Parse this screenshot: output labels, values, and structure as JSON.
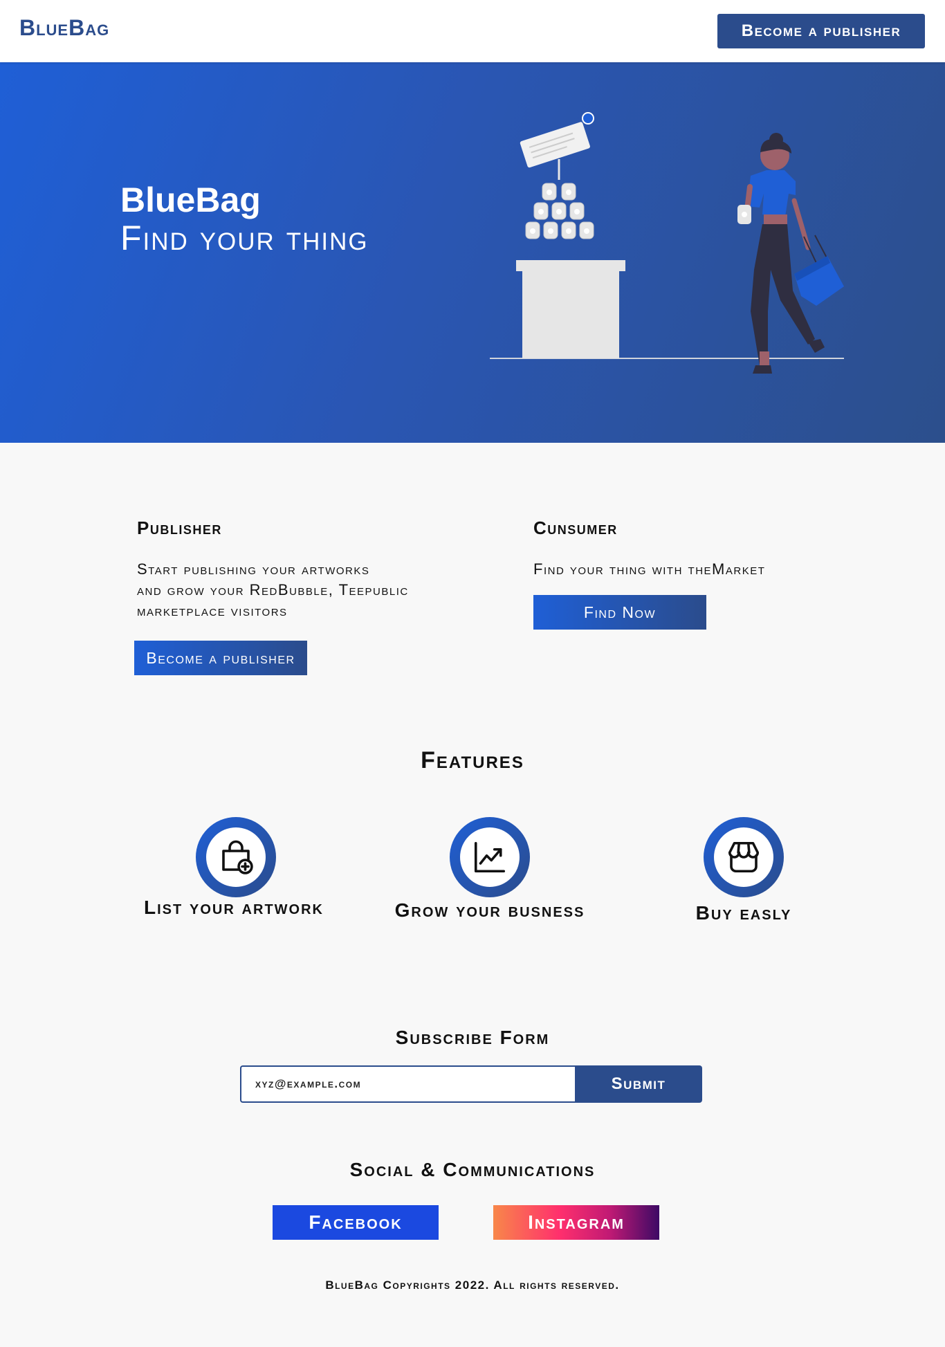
{
  "nav": {
    "brand": "BlueBag",
    "cta_label": "Become a publisher"
  },
  "hero": {
    "title": "BlueBag",
    "subtitle": "Find your thing"
  },
  "publisher": {
    "heading": "Publisher",
    "lines": [
      "Start publishing your artworks",
      "and grow your RedBubble, Teepublic",
      "marketplace visitors"
    ],
    "button_label": "Become a publisher"
  },
  "consumer": {
    "heading": "Cunsumer",
    "text": "Find your thing with theMarket",
    "button_label": "Find Now"
  },
  "features": {
    "title": "Features",
    "items": [
      {
        "icon": "bag-plus-icon",
        "label": "List your artwork"
      },
      {
        "icon": "chart-line-icon",
        "label": "Grow your busness"
      },
      {
        "icon": "storefront-icon",
        "label": "Buy easly"
      }
    ]
  },
  "subscribe": {
    "title": "Subscribe Form",
    "placeholder": "xyz@example.com",
    "submit_label": "Submit"
  },
  "social": {
    "title": "Social & Communications",
    "facebook_label": "Facebook",
    "instagram_label": "Instagram"
  },
  "footer": {
    "text": "BlueBag Copyrights 2022. All rights reserved."
  },
  "colors": {
    "brand_blue": "#2b4c8c",
    "accent_blue": "#1f5fd6",
    "facebook_blue": "#1b49e0"
  }
}
